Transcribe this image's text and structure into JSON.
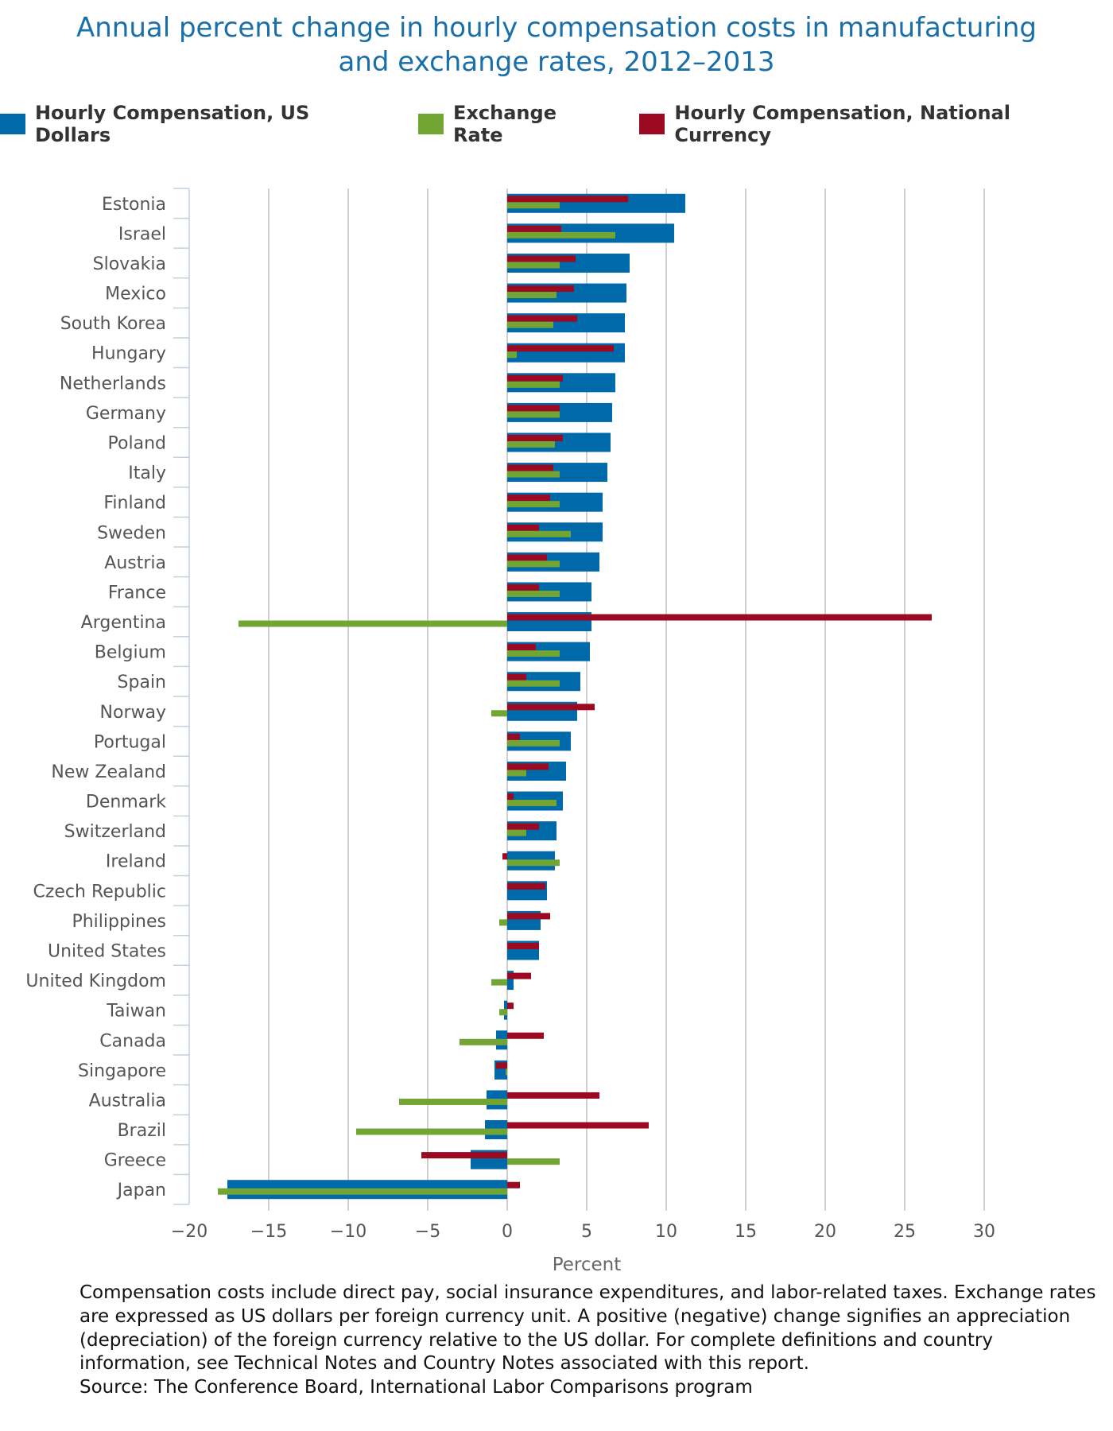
{
  "chart_data": {
    "type": "bar",
    "orientation": "horizontal",
    "title": "Annual percent change in hourly compensation costs in manufacturing and exchange rates, 2012–2013",
    "title_lines": [
      "Annual percent change in hourly compensation costs in manufacturing",
      "and exchange rates, 2012–2013"
    ],
    "xlabel": "Percent",
    "ylabel": "",
    "xlim": [
      -20,
      30
    ],
    "xticks": [
      -20,
      -15,
      -10,
      -5,
      0,
      5,
      10,
      15,
      20,
      25,
      30
    ],
    "xtick_labels": [
      "−20",
      "−15",
      "−10",
      "−5",
      "0",
      "5",
      "10",
      "15",
      "20",
      "25",
      "30"
    ],
    "grid": "vertical",
    "legend_position": "top",
    "categories": [
      "Estonia",
      "Israel",
      "Slovakia",
      "Mexico",
      "South Korea",
      "Hungary",
      "Netherlands",
      "Germany",
      "Poland",
      "Italy",
      "Finland",
      "Sweden",
      "Austria",
      "France",
      "Argentina",
      "Belgium",
      "Spain",
      "Norway",
      "Portugal",
      "New Zealand",
      "Denmark",
      "Switzerland",
      "Ireland",
      "Czech Republic",
      "Philippines",
      "United States",
      "United Kingdom",
      "Taiwan",
      "Canada",
      "Singapore",
      "Australia",
      "Brazil",
      "Greece",
      "Japan"
    ],
    "series": [
      {
        "name": "Hourly Compensation, US Dollars",
        "color": "#0069aa",
        "values": [
          11.2,
          10.5,
          7.7,
          7.5,
          7.4,
          7.4,
          6.8,
          6.6,
          6.5,
          6.3,
          6.0,
          6.0,
          5.8,
          5.3,
          5.3,
          5.2,
          4.6,
          4.4,
          4.0,
          3.7,
          3.5,
          3.1,
          3.0,
          2.5,
          2.1,
          2.0,
          0.4,
          -0.2,
          -0.7,
          -0.8,
          -1.3,
          -1.4,
          -2.3,
          -17.6
        ]
      },
      {
        "name": "Exchange Rate",
        "color": "#72a534",
        "values": [
          3.3,
          6.8,
          3.3,
          3.1,
          2.9,
          0.6,
          3.3,
          3.3,
          3.0,
          3.3,
          3.3,
          4.0,
          3.3,
          3.3,
          -16.9,
          3.3,
          3.3,
          -1.0,
          3.3,
          1.2,
          3.1,
          1.2,
          3.3,
          0.0,
          -0.5,
          0.0,
          -1.0,
          -0.5,
          -3.0,
          -0.1,
          -6.8,
          -9.5,
          3.3,
          -18.2
        ]
      },
      {
        "name": "Hourly Compensation, National Currency",
        "color": "#9c0a22",
        "values": [
          7.6,
          3.4,
          4.3,
          4.2,
          4.4,
          6.7,
          3.5,
          3.3,
          3.5,
          2.9,
          2.7,
          2.0,
          2.5,
          2.0,
          26.7,
          1.8,
          1.2,
          5.5,
          0.8,
          2.6,
          0.4,
          2.0,
          -0.3,
          2.4,
          2.7,
          2.0,
          1.5,
          0.4,
          2.3,
          -0.7,
          5.8,
          8.9,
          -5.4,
          0.8
        ]
      }
    ]
  },
  "footnote": {
    "lines": [
      "Compensation costs include direct pay, social insurance expenditures, and labor-related taxes. Exchange rates",
      "are expressed as US dollars per foreign currency unit. A positive (negative) change signifies an appreciation",
      "(depreciation) of the foreign currency relative to the US dollar. For complete definitions and country",
      "information, see Technical Notes and Country Notes associated with this report."
    ],
    "source": "Source: The Conference Board, International Labor Comparisons program"
  }
}
